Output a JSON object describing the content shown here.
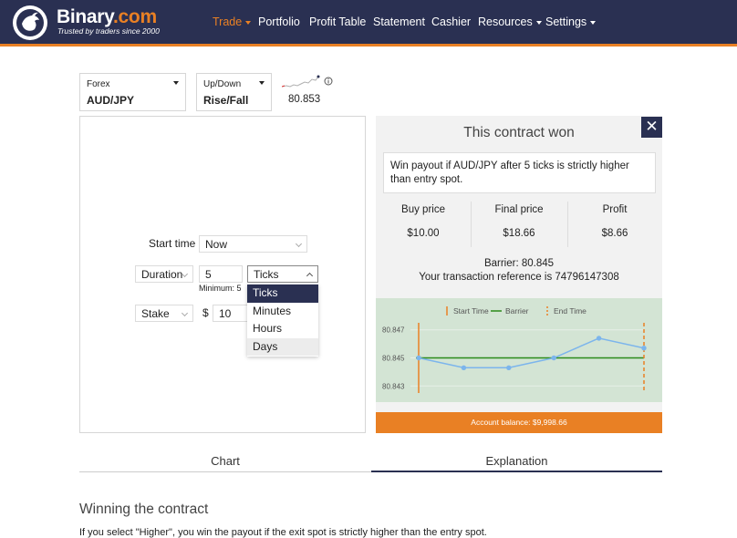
{
  "header": {
    "brand_name": "Binary",
    "brand_suffix": ".com",
    "tagline": "Trusted by traders since 2000",
    "nav": [
      {
        "label": "Trade",
        "dropdown": true,
        "active": true
      },
      {
        "label": "Portfolio",
        "dropdown": false,
        "active": false
      },
      {
        "label": "Profit Table",
        "dropdown": false,
        "active": false
      },
      {
        "label": "Statement",
        "dropdown": false,
        "active": false
      },
      {
        "label": "Cashier",
        "dropdown": false,
        "active": false
      },
      {
        "label": "Resources",
        "dropdown": true,
        "active": false
      },
      {
        "label": "Settings",
        "dropdown": true,
        "active": false
      }
    ]
  },
  "market": {
    "category": "Forex",
    "symbol": "AUD/JPY",
    "trade_type_category": "Up/Down",
    "trade_type": "Rise/Fall",
    "spot": "80.853",
    "info_icon": "info-icon"
  },
  "form": {
    "start_time_label": "Start time",
    "start_time_value": "Now",
    "duration_label": "Duration",
    "duration_value": "5",
    "duration_unit": "Ticks",
    "minimum_text": "Minimum: 5",
    "duration_unit_options": [
      "Ticks",
      "Minutes",
      "Hours",
      "Days"
    ],
    "stake_label": "Stake",
    "currency_symbol": "$",
    "stake_value": "10"
  },
  "result": {
    "title": "This contract won",
    "close_icon": "close-icon",
    "description": "Win payout if AUD/JPY after 5 ticks is strictly higher than entry spot.",
    "columns": [
      {
        "label": "Buy price",
        "value": "$10.00"
      },
      {
        "label": "Final price",
        "value": "$18.66"
      },
      {
        "label": "Profit",
        "value": "$8.66"
      }
    ],
    "barrier_text": "Barrier: 80.845",
    "transaction_text": "Your transaction reference is 74796147308",
    "balance_text": "Account balance: $9,998.66"
  },
  "chart_data": {
    "type": "line",
    "title": "",
    "xlabel": "",
    "ylabel": "",
    "legend": [
      "Start Time",
      "Barrier",
      "End Time"
    ],
    "legend_position": "top",
    "y_ticks": [
      "80.847",
      "80.845",
      "80.843"
    ],
    "ylim": [
      80.8425,
      80.8475
    ],
    "x": [
      1,
      2,
      3,
      4,
      5,
      6
    ],
    "series": [
      {
        "values": [
          80.845,
          80.8443,
          80.8443,
          80.845,
          80.8464,
          80.8457
        ]
      }
    ],
    "barrier": 80.845,
    "start_index": 1,
    "end_index": 6,
    "colors": {
      "line": "#7cb5ec",
      "barrier": "#2b8a1a",
      "start_end": "#e98024",
      "background": "#d3e4d4"
    }
  },
  "tabs": [
    {
      "label": "Chart",
      "active": false
    },
    {
      "label": "Explanation",
      "active": true
    }
  ],
  "explanation": {
    "heading": "Winning the contract",
    "body": "If you select \"Higher\", you win the payout if the exit spot is strictly higher than the entry spot."
  },
  "colors": {
    "header_bg": "#2a3052",
    "accent": "#e98024"
  }
}
